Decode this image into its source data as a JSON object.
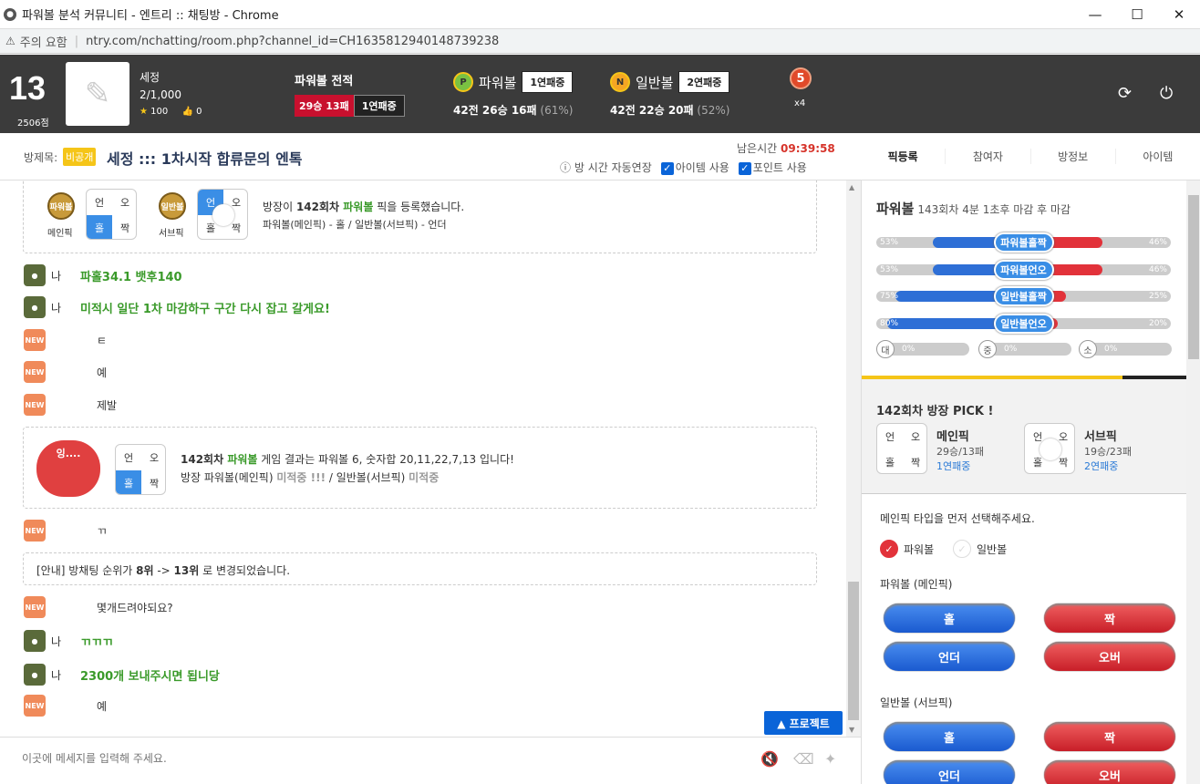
{
  "window": {
    "title": "파워볼 분석 커뮤니티 - 엔트리 :: 채팅방 - Chrome"
  },
  "address": {
    "warning": "주의 요함",
    "url": "ntry.com/nchatting/room.php?channel_id=CH1635812940148739238"
  },
  "profile": {
    "level": "13",
    "points": "2506점",
    "name": "세정",
    "count": "2/1,000",
    "stars": "100",
    "likes": "0"
  },
  "record": {
    "title": "파워볼 전적",
    "winloss": "29승 13패",
    "streak": "1연패중"
  },
  "powerball": {
    "icon": "P",
    "name": "파워볼",
    "streak": "1연패중",
    "stats": "42전 26승 16패",
    "pct": "(61%)"
  },
  "normalball": {
    "icon": "N",
    "name": "일반볼",
    "streak": "2연패중",
    "stats": "42전 22승 20패",
    "pct": "(52%)"
  },
  "medal": {
    "num": "5",
    "mult": "x4"
  },
  "room": {
    "label": "방제목:",
    "public": "비공개",
    "title": "세정 ::: 1차시작 합류문의 엔톡",
    "remain_label": "남은시간",
    "remain": "09:39:58",
    "ext": "방 시간 자동연장",
    "opt_item": "아이템 사용",
    "opt_point": "포인트 사용"
  },
  "tabs": [
    "픽등록",
    "참여자",
    "방정보",
    "아이템"
  ],
  "chat": {
    "pick1": {
      "main_lbl": "메인픽",
      "sub_lbl": "서브픽",
      "main_ball": "파워볼",
      "sub_ball": "일반볼",
      "cells": [
        "언",
        "오",
        "홀",
        "짝"
      ],
      "text1_a": "방장이 ",
      "text1_b": "142회차 ",
      "text1_c": "파워볼",
      "text1_d": " 픽을 등록했습니다.",
      "text2": "파워볼(메인픽) - 홀 / 일반볼(서브픽) - 언더"
    },
    "msgs": [
      {
        "who": "나",
        "text": "파홀34.1 뱃후140"
      },
      {
        "who": "나",
        "text": "미적시 일단 1차 마감하구 구간 다시 잡고 갈게요!"
      },
      {
        "who": "",
        "text": "ㅌ"
      },
      {
        "who": "",
        "text": "예"
      },
      {
        "who": "",
        "text": "제발"
      }
    ],
    "result": {
      "a": "142회차 ",
      "b": "파워볼",
      "c": " 게임 결과는 파워볼 6, 숫자합 20,11,22,7,13 입니다!",
      "d": "방장 파워볼(메인픽) ",
      "e": "미적중 !!!",
      "f": " / 일반볼(서브픽) ",
      "g": "미적중",
      "emoji": "잉....",
      "cells": [
        "언",
        "오",
        "홀",
        "짝"
      ]
    },
    "msgs2": [
      {
        "who": "",
        "text": "ㄲ"
      }
    ],
    "notice": {
      "a": "[안내] 방채팅 순위가 ",
      "b": "8위",
      "c": " -> ",
      "d": "13위",
      "e": " 로 변경되었습니다."
    },
    "msgs3": [
      {
        "who": "",
        "text": "몇개드려야되요?"
      },
      {
        "who": "나",
        "text": "ㄲㄲㄲ"
      },
      {
        "who": "나",
        "text": "2300개 보내주시면 됩니당"
      },
      {
        "who": "",
        "text": "예"
      }
    ],
    "new_badge": "NEW",
    "project_btn": "▲ 프로젝트"
  },
  "input": {
    "placeholder": "이곳에 메세지를 입력해 주세요."
  },
  "stats": {
    "title": "파워볼",
    "sub": "143회차 4분 1초후 마감 후 마감",
    "bars": [
      {
        "label": "파워볼홀짝",
        "left": "53%",
        "right": "46%",
        "l": 0.53,
        "r": 0.46
      },
      {
        "label": "파워볼언오",
        "left": "53%",
        "right": "46%",
        "l": 0.53,
        "r": 0.46
      },
      {
        "label": "일반볼홀짝",
        "left": "75%",
        "right": "25%",
        "l": 0.75,
        "r": 0.25
      },
      {
        "label": "일반볼언오",
        "left": "80%",
        "right": "20%",
        "l": 0.8,
        "r": 0.2
      }
    ],
    "sizes": [
      {
        "k": "대",
        "v": "0%"
      },
      {
        "k": "중",
        "v": "0%"
      },
      {
        "k": "소",
        "v": "0%"
      }
    ]
  },
  "hostpick": {
    "title": "142회차 방장 PICK !",
    "main": {
      "label": "메인픽",
      "rec": "29승/13패",
      "streak": "1연패중"
    },
    "sub": {
      "label": "서브픽",
      "rec": "19승/23패",
      "streak": "2연패중"
    },
    "cells": [
      "언",
      "오",
      "홀",
      "짝"
    ]
  },
  "select": {
    "title": "메인픽 타입을 먼저 선택해주세요.",
    "opt1": "파워볼",
    "opt2": "일반볼",
    "grp1": "파워볼 (메인픽)",
    "grp2": "일반볼 (서브픽)",
    "btns": [
      "홀",
      "짝",
      "언더",
      "오버"
    ]
  },
  "colors": {
    "accent": "#0a64d8",
    "red": "#e2323a",
    "green": "#3a9a2a",
    "header": "#3b3b3b"
  }
}
